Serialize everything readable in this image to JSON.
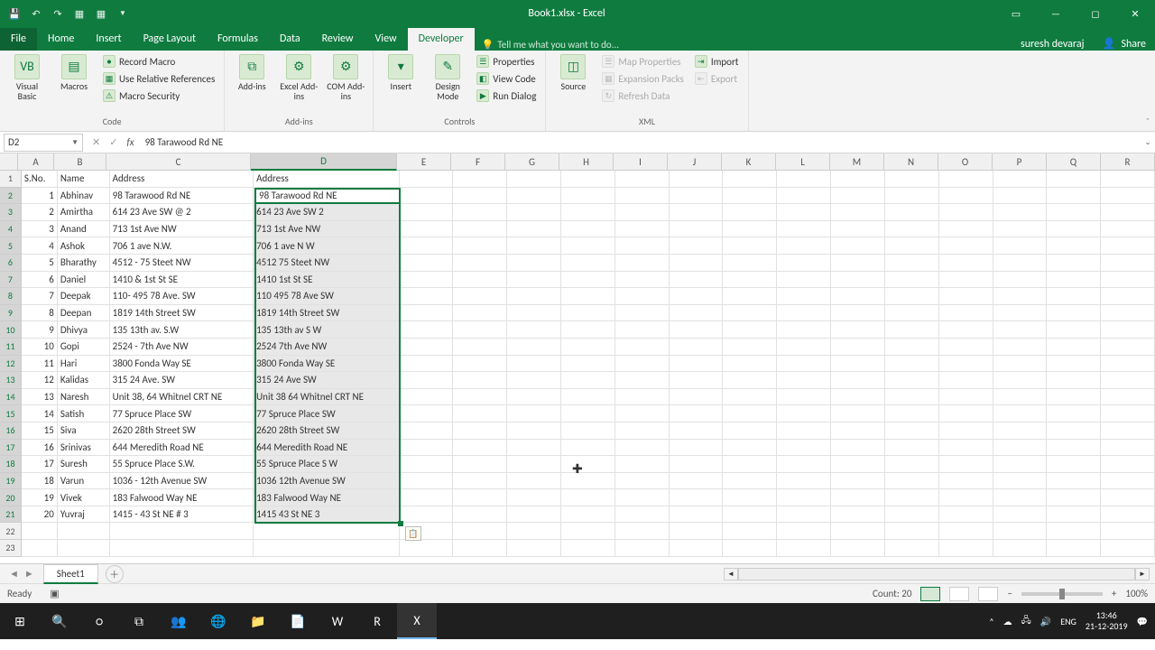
{
  "titlebar": {
    "title": "Book1.xlsx - Excel"
  },
  "ribbon": {
    "tabs": [
      "File",
      "Home",
      "Insert",
      "Page Layout",
      "Formulas",
      "Data",
      "Review",
      "View",
      "Developer"
    ],
    "active_tab": "Developer",
    "tellme": "Tell me what you want to do...",
    "user": "suresh devaraj",
    "share": "Share",
    "groups": {
      "code": {
        "label": "Code",
        "visual_basic": "Visual Basic",
        "macros": "Macros",
        "record_macro": "Record Macro",
        "use_relative": "Use Relative References",
        "macro_security": "Macro Security"
      },
      "addins": {
        "label": "Add-ins",
        "addins": "Add-ins",
        "excel_addins": "Excel Add-ins",
        "com_addins": "COM Add-ins"
      },
      "controls": {
        "label": "Controls",
        "insert": "Insert",
        "design_mode": "Design Mode",
        "properties": "Properties",
        "view_code": "View Code",
        "run_dialog": "Run Dialog"
      },
      "xml": {
        "label": "XML",
        "source": "Source",
        "map_properties": "Map Properties",
        "expansion_packs": "Expansion Packs",
        "refresh_data": "Refresh Data",
        "import": "Import",
        "export": "Export"
      }
    }
  },
  "formula_bar": {
    "cell_ref": "D2",
    "formula": "98 Tarawood Rd NE"
  },
  "sheet": {
    "columns": [
      "A",
      "B",
      "C",
      "D",
      "E",
      "F",
      "G",
      "H",
      "I",
      "J",
      "K",
      "L",
      "M",
      "N",
      "O",
      "P",
      "Q",
      "R"
    ],
    "selected_col": "D",
    "headers": {
      "A": "S.No.",
      "B": "Name",
      "C": "Address",
      "D": "Address"
    },
    "data": [
      {
        "n": "1",
        "name": "Abhinav",
        "c": "98 Tarawood Rd NE",
        "d": "98 Tarawood Rd NE"
      },
      {
        "n": "2",
        "name": "Amirtha",
        "c": "614 23 Ave SW @ 2",
        "d": "614 23 Ave SW   2"
      },
      {
        "n": "3",
        "name": "Anand",
        "c": "713 1st Ave NW",
        "d": "713 1st Ave NW"
      },
      {
        "n": "4",
        "name": "Ashok",
        "c": "706 1 ave N.W.",
        "d": "706 1 ave N W"
      },
      {
        "n": "5",
        "name": "Bharathy",
        "c": "4512 - 75 Steet NW",
        "d": "4512   75 Steet NW"
      },
      {
        "n": "6",
        "name": "Daniel",
        "c": "1410 & 1st St SE",
        "d": "1410   1st St SE"
      },
      {
        "n": "7",
        "name": "Deepak",
        "c": "110- 495 78 Ave. SW",
        "d": "110  495 78 Ave  SW"
      },
      {
        "n": "8",
        "name": "Deepan",
        "c": "1819 14th Street SW",
        "d": "1819 14th Street SW"
      },
      {
        "n": "9",
        "name": "Dhivya",
        "c": "135 13th av. S.W",
        "d": "135 13th av  S W"
      },
      {
        "n": "10",
        "name": "Gopi",
        "c": "2524 - 7th Ave NW",
        "d": "2524   7th Ave NW"
      },
      {
        "n": "11",
        "name": "Hari",
        "c": "3800 Fonda Way SE",
        "d": "3800 Fonda Way SE"
      },
      {
        "n": "12",
        "name": "Kalidas",
        "c": "315 24 Ave. SW",
        "d": "315 24 Ave  SW"
      },
      {
        "n": "13",
        "name": "Naresh",
        "c": "Unit 38, 64 Whitnel CRT NE",
        "d": "Unit 38  64 Whitnel CRT NE"
      },
      {
        "n": "14",
        "name": "Satish",
        "c": "77 Spruce Place SW",
        "d": "77 Spruce Place SW"
      },
      {
        "n": "15",
        "name": "Siva",
        "c": "2620 28th Street SW",
        "d": "2620 28th Street SW"
      },
      {
        "n": "16",
        "name": "Srinivas",
        "c": "644 Meredith Road NE",
        "d": "644 Meredith Road NE"
      },
      {
        "n": "17",
        "name": "Suresh",
        "c": "55 Spruce Place S.W.",
        "d": "55 Spruce Place S W"
      },
      {
        "n": "18",
        "name": "Varun",
        "c": "1036 - 12th Avenue SW",
        "d": "1036   12th Avenue SW"
      },
      {
        "n": "19",
        "name": "Vivek",
        "c": "183 Falwood Way NE",
        "d": "183 Falwood Way NE"
      },
      {
        "n": "20",
        "name": "Yuvraj",
        "c": "1415 - 43 St NE # 3",
        "d": "1415   43 St NE   3"
      }
    ],
    "tab_name": "Sheet1"
  },
  "statusbar": {
    "ready": "Ready",
    "count_label": "Count: 20",
    "zoom": "100%"
  },
  "taskbar": {
    "time": "13:46",
    "date": "21-12-2019",
    "lang": "ENG"
  }
}
